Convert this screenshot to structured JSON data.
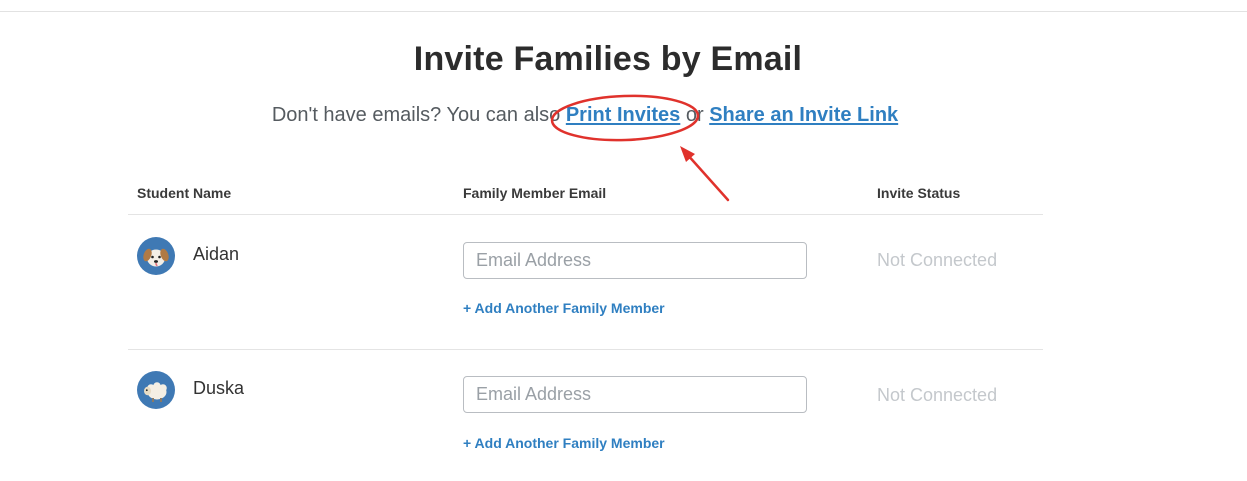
{
  "header": {
    "title": "Invite Families by Email",
    "subtitle_prefix": "Don't have emails? You can also ",
    "print_invites_link": "Print Invites",
    "subtitle_or": " or ",
    "share_link": "Share an Invite Link"
  },
  "table": {
    "columns": {
      "student_name": "Student Name",
      "family_email": "Family Member Email",
      "invite_status": "Invite Status"
    },
    "rows": [
      {
        "name": "Aidan",
        "avatar": "puppy-face-icon",
        "email_placeholder": "Email Address",
        "add_member_label": "+ Add Another Family Member",
        "status": "Not Connected"
      },
      {
        "name": "Duska",
        "avatar": "sheep-icon",
        "email_placeholder": "Email Address",
        "add_member_label": "+ Add Another Family Member",
        "status": "Not Connected"
      }
    ]
  },
  "colors": {
    "link": "#2f7fc1",
    "avatar_bg": "#3f79b4",
    "annotation": "#e0322c",
    "status": "#c4c8cc"
  }
}
